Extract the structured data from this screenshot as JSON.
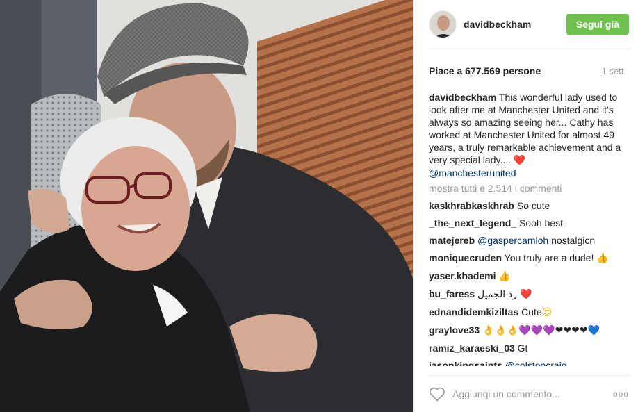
{
  "post": {
    "username": "davidbeckham",
    "follow_label": "Segui già",
    "likes": "Piace a 677.569 persone",
    "time_ago": "1 sett.",
    "caption": {
      "username": "davidbeckham",
      "text": "This wonderful lady used to look after me at Manchester United and it's always so amazing seeing her... Cathy has worked at Manchester United for almost 49 years, a truly remarkable achievement and a very special lady.... ",
      "emoji": "❤️",
      "mention": "@manchesterunited"
    },
    "show_all_comments": "mostra tutti e 2.514 i commenti",
    "comments": [
      {
        "user": "kaskhrabkaskhrab",
        "text": "So cute"
      },
      {
        "user": "_the_next_legend_",
        "text": "Sooh best"
      },
      {
        "user": "matejereb",
        "mention": "@gaspercamloh",
        "text": "nostalgicn"
      },
      {
        "user": "moniquecruden",
        "text": "You truly are a dude!",
        "emoji": "👍"
      },
      {
        "user": "yaser.khademi",
        "emoji": "👍"
      },
      {
        "user": "bu_faress",
        "text": "رد الجميل",
        "emoji": "❤️"
      },
      {
        "user": "ednandidemkiziltas",
        "text": "Cute",
        "emoji": "😍"
      },
      {
        "user": "graylove33",
        "emoji": "👌👌👌💜💜💜❤❤❤❤💙"
      },
      {
        "user": "ramiz_karaeski_03",
        "text": "Gt"
      },
      {
        "user": "jasonkingsaints",
        "mention": "@colstoncraig"
      }
    ],
    "comment_placeholder": "Aggiungi un commento...",
    "more_label": "ooo"
  }
}
